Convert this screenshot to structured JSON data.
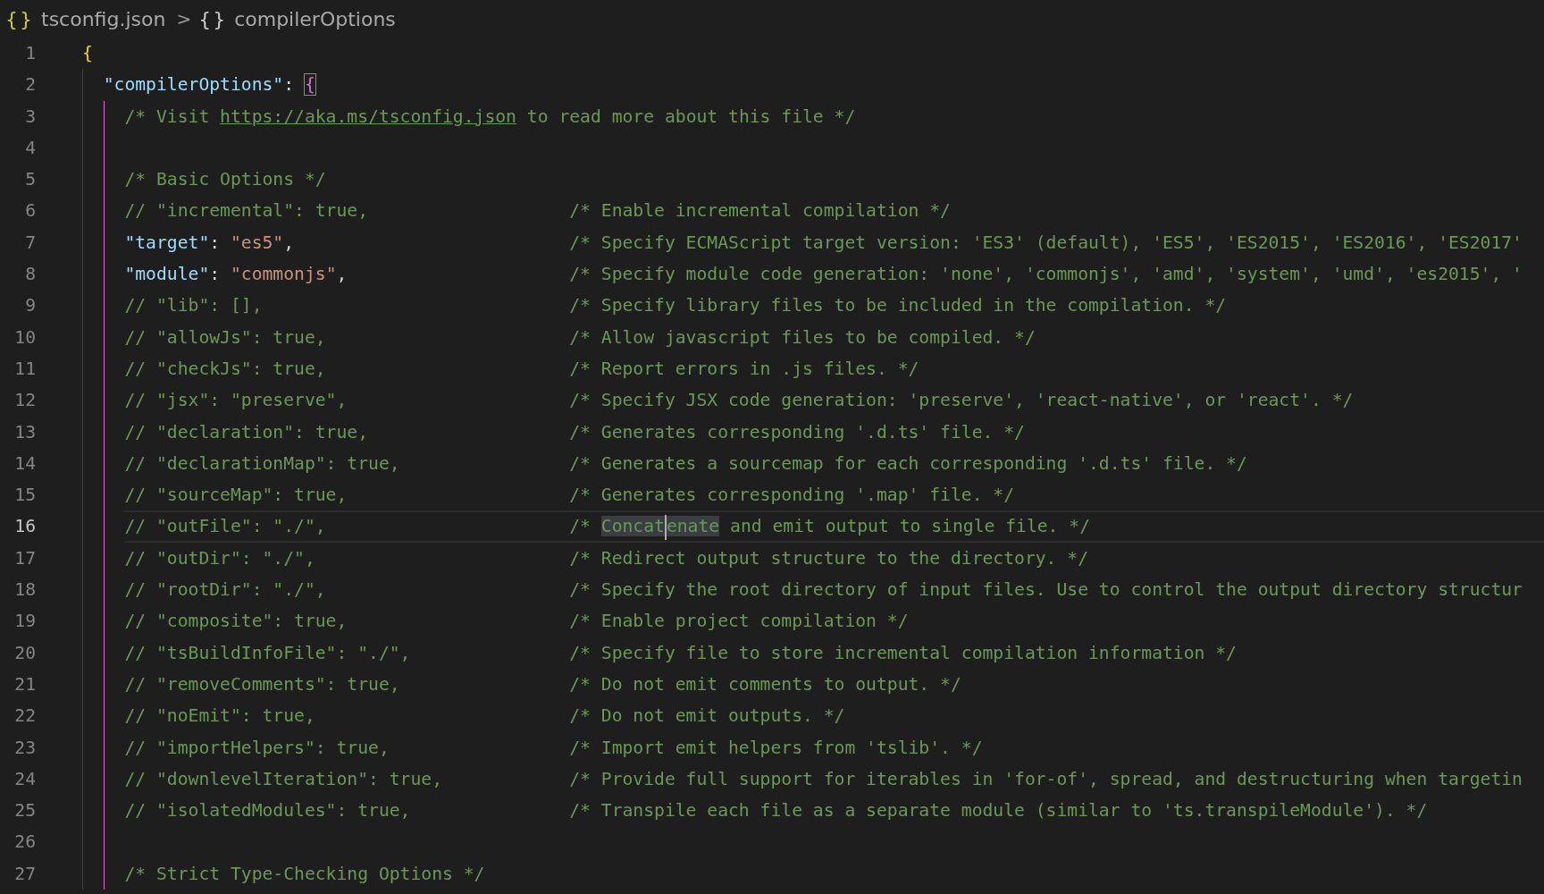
{
  "breadcrumb": [
    {
      "icon": "{}",
      "label": "tsconfig.json",
      "kind": "file"
    },
    {
      "icon": "{}",
      "label": "compilerOptions",
      "kind": "symbol"
    }
  ],
  "separator": ">",
  "lines": [
    {
      "number": "1",
      "current": false,
      "tokens": [
        {
          "kind": "brace",
          "text": "{"
        }
      ],
      "children": [
        {
          "number": "2",
          "current": false,
          "tokens": [
            {
              "kind": "key",
              "text": "\"compilerOptions\""
            },
            {
              "kind": "punct",
              "text": ": "
            },
            {
              "kind": "brace-match",
              "text": "{"
            }
          ],
          "children": [
            {
              "number": "3",
              "current": false,
              "tokens": [
                {
                  "kind": "comment",
                  "text": "/* Visit "
                },
                {
                  "kind": "link",
                  "text": "https://aka.ms/tsconfig.json"
                },
                {
                  "kind": "comment",
                  "text": " to read more about this file */"
                }
              ]
            },
            {
              "number": "4",
              "current": false
            },
            {
              "number": "5",
              "current": false,
              "tokens": [
                {
                  "kind": "comment",
                  "text": "/* Basic Options */"
                }
              ]
            },
            {
              "number": "6",
              "current": false,
              "tokens": [
                {
                  "kind": "comment",
                  "text": "// \"incremental\": true,"
                }
              ],
              "trailing": [
                {
                  "kind": "comment",
                  "text": "/* Enable incremental compilation */"
                }
              ]
            },
            {
              "number": "7",
              "current": false,
              "tokens": [
                {
                  "kind": "key",
                  "text": "\"target\""
                },
                {
                  "kind": "punct",
                  "text": ": "
                },
                {
                  "kind": "string",
                  "text": "\"es5\""
                },
                {
                  "kind": "punct",
                  "text": ","
                }
              ],
              "trailing": [
                {
                  "kind": "comment",
                  "text": "/* Specify ECMAScript target version: 'ES3' (default), 'ES5', 'ES2015', 'ES2016', 'ES2017'"
                }
              ]
            },
            {
              "number": "8",
              "current": false,
              "tokens": [
                {
                  "kind": "key",
                  "text": "\"module\""
                },
                {
                  "kind": "punct",
                  "text": ": "
                },
                {
                  "kind": "string",
                  "text": "\"commonjs\""
                },
                {
                  "kind": "punct",
                  "text": ","
                }
              ],
              "trailing": [
                {
                  "kind": "comment",
                  "text": "/* Specify module code generation: 'none', 'commonjs', 'amd', 'system', 'umd', 'es2015', '"
                }
              ]
            },
            {
              "number": "9",
              "current": false,
              "tokens": [
                {
                  "kind": "comment",
                  "text": "// \"lib\": [],"
                }
              ],
              "trailing": [
                {
                  "kind": "comment",
                  "text": "/* Specify library files to be included in the compilation. */"
                }
              ]
            },
            {
              "number": "10",
              "current": false,
              "tokens": [
                {
                  "kind": "comment",
                  "text": "// \"allowJs\": true,"
                }
              ],
              "trailing": [
                {
                  "kind": "comment",
                  "text": "/* Allow javascript files to be compiled. */"
                }
              ]
            },
            {
              "number": "11",
              "current": false,
              "tokens": [
                {
                  "kind": "comment",
                  "text": "// \"checkJs\": true,"
                }
              ],
              "trailing": [
                {
                  "kind": "comment",
                  "text": "/* Report errors in .js files. */"
                }
              ]
            },
            {
              "number": "12",
              "current": false,
              "tokens": [
                {
                  "kind": "comment",
                  "text": "// \"jsx\": \"preserve\","
                }
              ],
              "trailing": [
                {
                  "kind": "comment",
                  "text": "/* Specify JSX code generation: 'preserve', 'react-native', or 'react'. */"
                }
              ]
            },
            {
              "number": "13",
              "current": false,
              "tokens": [
                {
                  "kind": "comment",
                  "text": "// \"declaration\": true,"
                }
              ],
              "trailing": [
                {
                  "kind": "comment",
                  "text": "/* Generates corresponding '.d.ts' file. */"
                }
              ]
            },
            {
              "number": "14",
              "current": false,
              "tokens": [
                {
                  "kind": "comment",
                  "text": "// \"declarationMap\": true,"
                }
              ],
              "trailing": [
                {
                  "kind": "comment",
                  "text": "/* Generates a sourcemap for each corresponding '.d.ts' file. */"
                }
              ]
            },
            {
              "number": "15",
              "current": false,
              "tokens": [
                {
                  "kind": "comment",
                  "text": "// \"sourceMap\": true,"
                }
              ],
              "trailing": [
                {
                  "kind": "comment",
                  "text": "/* Generates corresponding '.map' file. */"
                }
              ]
            },
            {
              "number": "16",
              "current": true,
              "tokens": [
                {
                  "kind": "comment",
                  "text": "// \"outFile\": \"./\","
                }
              ],
              "trailing": [
                {
                  "kind": "comment",
                  "text": "/* "
                },
                {
                  "kind": "selection",
                  "text": "Concat"
                },
                {
                  "kind": "cursor"
                },
                {
                  "kind": "selection",
                  "text": "enate"
                },
                {
                  "kind": "comment",
                  "text": " and emit output to single file. */"
                }
              ]
            },
            {
              "number": "17",
              "current": false,
              "tokens": [
                {
                  "kind": "comment",
                  "text": "// \"outDir\": \"./\","
                }
              ],
              "trailing": [
                {
                  "kind": "comment",
                  "text": "/* Redirect output structure to the directory. */"
                }
              ]
            },
            {
              "number": "18",
              "current": false,
              "tokens": [
                {
                  "kind": "comment",
                  "text": "// \"rootDir\": \"./\","
                }
              ],
              "trailing": [
                {
                  "kind": "comment",
                  "text": "/* Specify the root directory of input files. Use to control the output directory structur"
                }
              ]
            },
            {
              "number": "19",
              "current": false,
              "tokens": [
                {
                  "kind": "comment",
                  "text": "// \"composite\": true,"
                }
              ],
              "trailing": [
                {
                  "kind": "comment",
                  "text": "/* Enable project compilation */"
                }
              ]
            },
            {
              "number": "20",
              "current": false,
              "tokens": [
                {
                  "kind": "comment",
                  "text": "// \"tsBuildInfoFile\": \"./\","
                }
              ],
              "trailing": [
                {
                  "kind": "comment",
                  "text": "/* Specify file to store incremental compilation information */"
                }
              ]
            },
            {
              "number": "21",
              "current": false,
              "tokens": [
                {
                  "kind": "comment",
                  "text": "// \"removeComments\": true,"
                }
              ],
              "trailing": [
                {
                  "kind": "comment",
                  "text": "/* Do not emit comments to output. */"
                }
              ]
            },
            {
              "number": "22",
              "current": false,
              "tokens": [
                {
                  "kind": "comment",
                  "text": "// \"noEmit\": true,"
                }
              ],
              "trailing": [
                {
                  "kind": "comment",
                  "text": "/* Do not emit outputs. */"
                }
              ]
            },
            {
              "number": "23",
              "current": false,
              "tokens": [
                {
                  "kind": "comment",
                  "text": "// \"importHelpers\": true,"
                }
              ],
              "trailing": [
                {
                  "kind": "comment",
                  "text": "/* Import emit helpers from 'tslib'. */"
                }
              ]
            },
            {
              "number": "24",
              "current": false,
              "tokens": [
                {
                  "kind": "comment",
                  "text": "// \"downlevelIteration\": true,"
                }
              ],
              "trailing": [
                {
                  "kind": "comment",
                  "text": "/* Provide full support for iterables in 'for-of', spread, and destructuring when targetin"
                }
              ]
            },
            {
              "number": "25",
              "current": false,
              "tokens": [
                {
                  "kind": "comment",
                  "text": "// \"isolatedModules\": true,"
                }
              ],
              "trailing": [
                {
                  "kind": "comment",
                  "text": "/* Transpile each file as a separate module (similar to 'ts.transpileModule'). */"
                }
              ]
            },
            {
              "number": "26",
              "current": false
            },
            {
              "number": "27",
              "current": false,
              "tokens": [
                {
                  "kind": "comment",
                  "text": "/* Strict Type-Checking Options */"
                }
              ]
            }
          ]
        }
      ]
    }
  ]
}
